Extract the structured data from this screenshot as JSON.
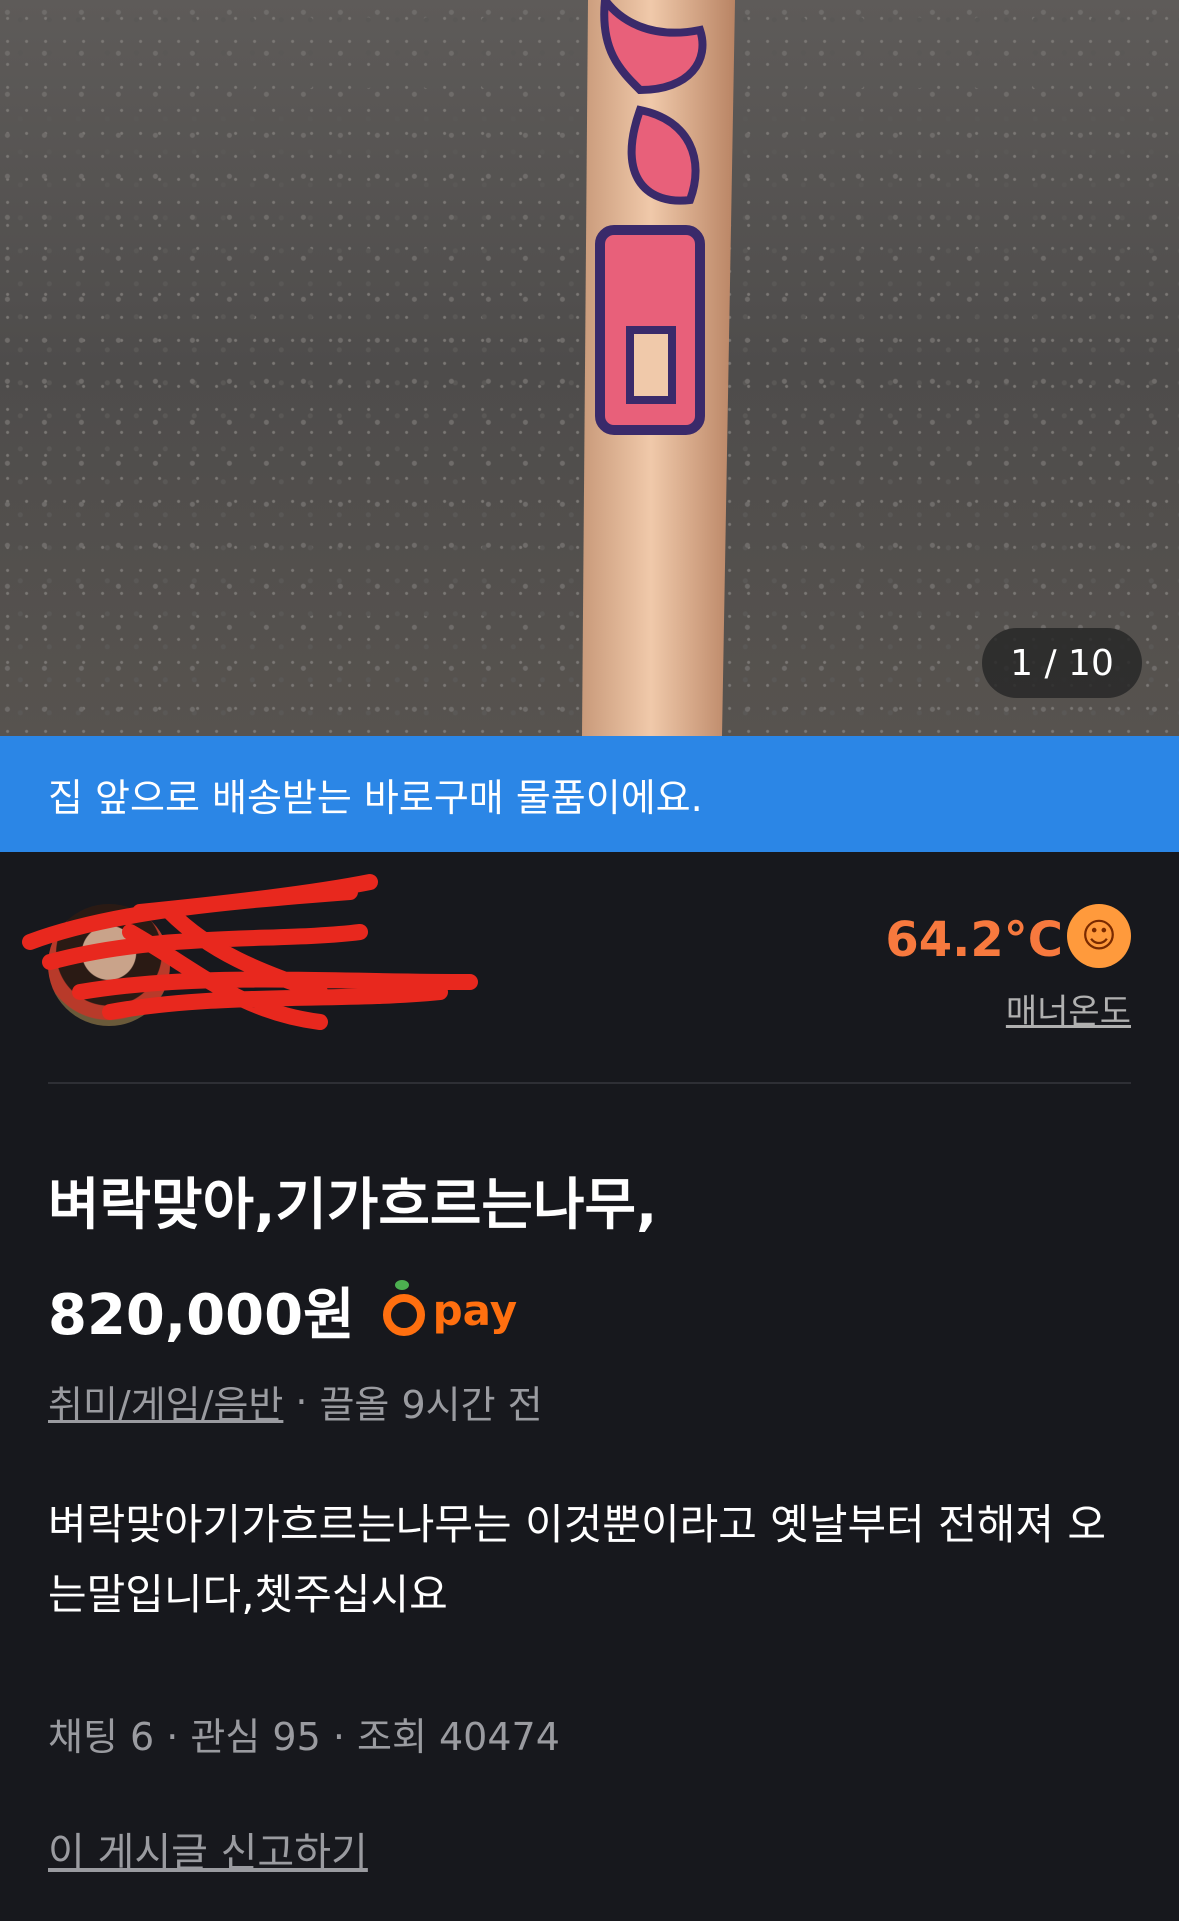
{
  "photo": {
    "pager": "1 / 10"
  },
  "banner": {
    "text": "집 앞으로 배송받는 바로구매 물품이에요."
  },
  "seller": {
    "temperature": "64.2°C",
    "temperature_icon": "smiling-face-icon",
    "manner_label": "매너온도"
  },
  "product": {
    "title": "벼락맞아,기가흐르는나무,",
    "price": "820,000원",
    "pay_label": "pay",
    "category": "취미/게임/음반",
    "time": "끌올 9시간 전",
    "description": "벼락맞아기가흐르는나무는 이것뿐이라고 옛날부터 전해져 오는말입니다,쳇주십시요",
    "stats": "채팅 6 · 관심 95 · 조회 40474"
  },
  "actions": {
    "report": "이 게시글 신고하기"
  },
  "colors": {
    "banner": "#2b86e6",
    "temperature": "#f7793e",
    "background": "#17181d",
    "pay": "#ff6f0f"
  }
}
